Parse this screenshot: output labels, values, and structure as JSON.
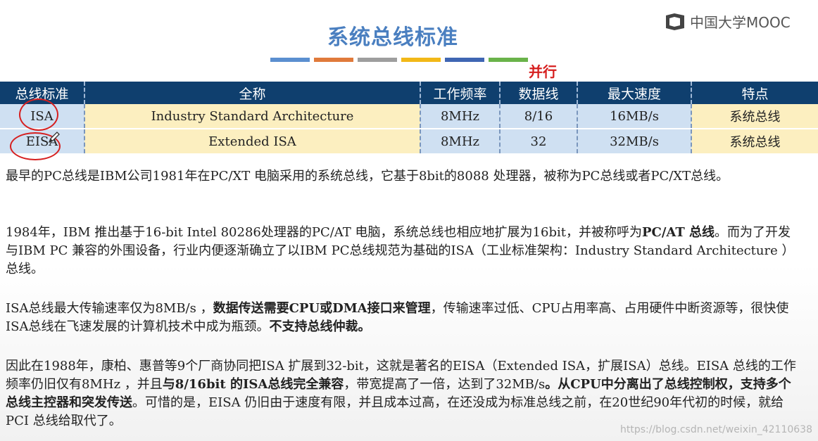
{
  "slide": {
    "title": "系统总线标准",
    "logo_text": "中国大学MOOC",
    "annotation": "并行",
    "stripe_colors": [
      "#5b8fd0",
      "#e07a3b",
      "#9e9e9e",
      "#f2b818",
      "#3f66b3",
      "#6ab34a"
    ]
  },
  "table": {
    "headers": [
      "总线标准",
      "全称",
      "工作频率",
      "数据线",
      "最大速度",
      "特点"
    ],
    "rows": [
      [
        "ISA",
        "Industry Standard Architecture",
        "8MHz",
        "8/16",
        "16MB/s",
        "系统总线"
      ],
      [
        "EISA",
        "Extended ISA",
        "8MHz",
        "32",
        "32MB/s",
        "系统总线"
      ]
    ]
  },
  "paragraphs": {
    "p1": "最早的PC总线是IBM公司1981年在PC/XT 电脑采用的系统总线，它基于8bit的8088 处理器，被称为PC总线或者PC/XT总线。",
    "p2_a": "1984年，IBM 推出基于16-bit Intel 80286处理器的PC/AT 电脑，系统总线也相应地扩展为16bit，并被称呼为",
    "p2_b": "PC/AT 总线",
    "p2_c": "。而为了开发与IBM PC 兼容的外围设备，行业内便逐渐确立了以IBM PC总线规范为基础的ISA（工业标准架构：Industry Standard Architecture ）总线。",
    "p3_a": "ISA总线最大传输速率仅为8MB/s ，",
    "p3_b": "数据传送需要CPU或DMA接口来管理",
    "p3_c": "，传输速率过低、CPU占用率高、占用硬件中断资源等，很快使ISA总线在飞速发展的计算机技术中成为瓶颈。",
    "p3_d": "不支持总线仲裁。",
    "p4_a": "因此在1988年，康柏、惠普等9个厂商协同把ISA 扩展到32-bit，这就是著名的EISA（Extended ISA，扩展ISA）总线。EISA 总线的工作频率仍旧仅有8MHz ，并且",
    "p4_b": "与8/16bit 的ISA总线完全兼容",
    "p4_c": "，带宽提高了一倍，达到了32MB/s",
    "p4_d": "。从CPU中分离出了总线控制权，支持多个总线主控器和突发传送",
    "p4_e": "。可惜的是，EISA 仍旧由于速度有限，并且成本过高，在还没成为标准总线之前，在20世纪90年代初的时候，就给PCI 总线给取代了。"
  },
  "watermark": "https://blog.csdn.net/weixin_42110638"
}
